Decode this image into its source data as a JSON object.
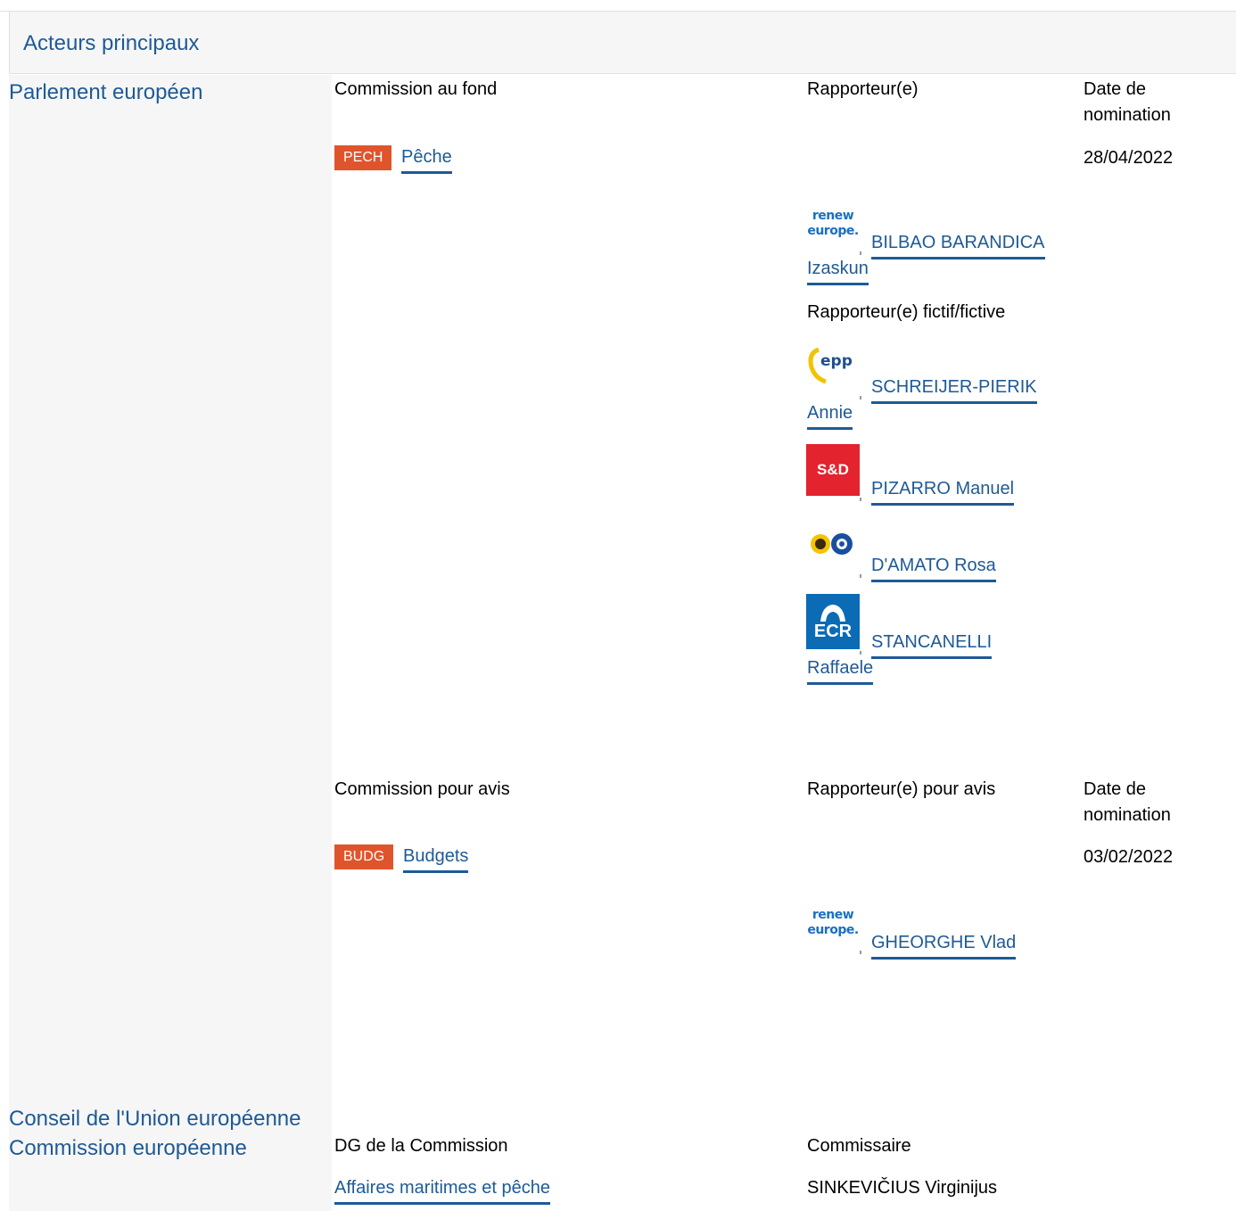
{
  "header": {
    "title": "Acteurs principaux"
  },
  "parliament": {
    "institution": "Parlement européen",
    "lead": {
      "committee_col": "Commission au fond",
      "rapporteur_col": "Rapporteur(e)",
      "date_col_line1": "Date de",
      "date_col_line2": "nomination",
      "committee": {
        "code": "PECH",
        "name": "Pêche",
        "date": "28/04/2022"
      },
      "rapporteur": {
        "line1": "BILBAO BARANDICA",
        "line2": "Izaskun",
        "group_logo": "renew-europe"
      },
      "shadow_label": "Rapporteur(e) fictif/fictive",
      "shadows": [
        {
          "line1": "SCHREIJER-PIERIK",
          "line2": "Annie",
          "group_logo": "epp"
        },
        {
          "line1": "PIZARRO Manuel",
          "group_logo": "s-and-d"
        },
        {
          "line1": "D'AMATO Rosa",
          "group_logo": "greens-efa"
        },
        {
          "line1": "STANCANELLI",
          "line2": "Raffaele",
          "group_logo": "ecr"
        }
      ]
    },
    "opinion": {
      "committee_col": "Commission pour avis",
      "rapporteur_col": "Rapporteur(e) pour avis",
      "date_col_line1": "Date de",
      "date_col_line2": "nomination",
      "committee": {
        "code": "BUDG",
        "name": "Budgets",
        "date": "03/02/2022"
      },
      "rapporteur": {
        "line1": "GHEORGHE Vlad",
        "group_logo": "renew-europe"
      }
    }
  },
  "council": {
    "institution": "Conseil de l'Union européenne"
  },
  "commission": {
    "institution": "Commission européenne",
    "dg_col": "DG de la Commission",
    "commissioner_col": "Commissaire",
    "dg": "Affaires maritimes et pêche",
    "commissioner": "SINKEVIČIUS Virginijus"
  },
  "logos": {
    "renew_line1": "renew",
    "renew_line2": "europe.",
    "epp": "epp",
    "snd": "S&D",
    "ecr": "ECR"
  },
  "colors": {
    "link": "#1e5a96",
    "badge": "#e0542c",
    "panel": "#f6f6f6"
  }
}
